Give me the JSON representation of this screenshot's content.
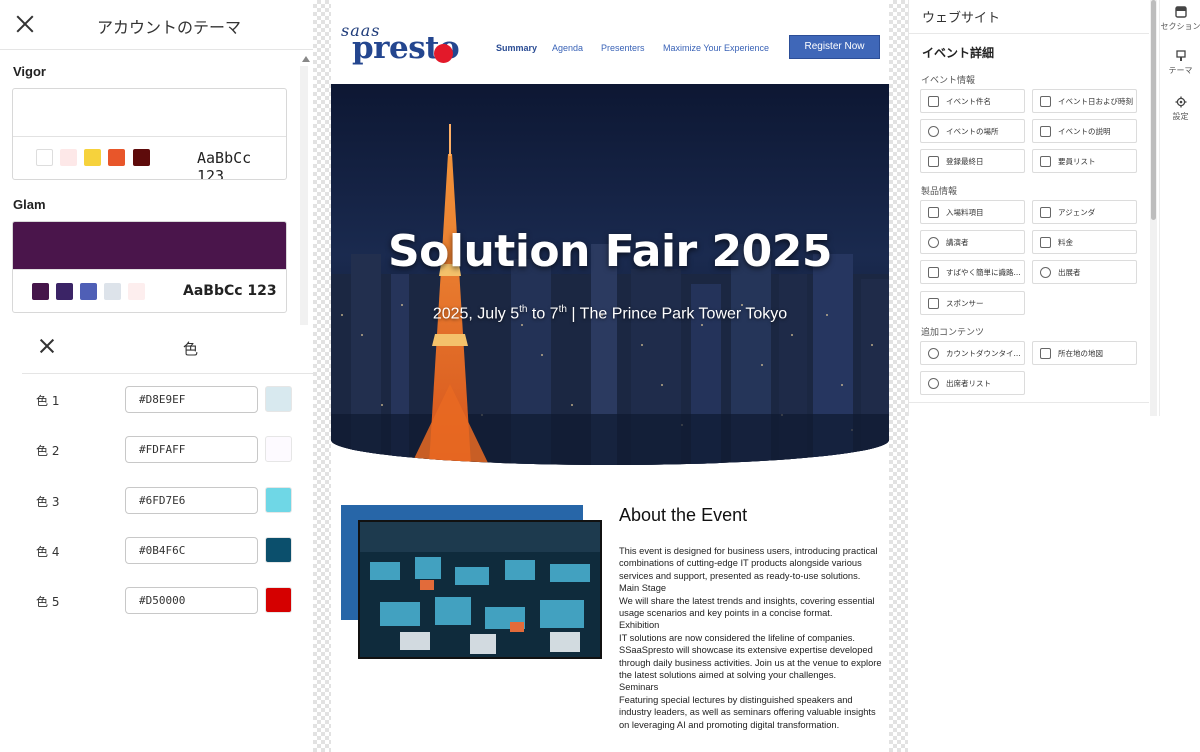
{
  "theme_panel": {
    "title": "アカウントのテーマ",
    "themes": [
      {
        "name": "Vigor",
        "sample": "AaBbCc 123",
        "colors": [
          "#ffffff",
          "#fde8e8",
          "#f6d23c",
          "#e8562a",
          "#5e0b0b"
        ]
      },
      {
        "name": "Glam",
        "sample": "AaBbCc 123",
        "top_color": "#4a154b",
        "colors": [
          "#45154a",
          "#3b2466",
          "#4f5fb6",
          "#dde3ea",
          "#fdeeee"
        ]
      }
    ]
  },
  "color_panel": {
    "title": "色",
    "colors": [
      {
        "label": "色 1",
        "hex": "#D8E9EF",
        "swatch": "#D8E9EF"
      },
      {
        "label": "色 2",
        "hex": "#FDFAFF",
        "swatch": "#FDFAFF"
      },
      {
        "label": "色 3",
        "hex": "#6FD7E6",
        "swatch": "#6FD7E6"
      },
      {
        "label": "色 4",
        "hex": "#0B4F6C",
        "swatch": "#0B4F6C"
      },
      {
        "label": "色 5",
        "hex": "#D50000",
        "swatch": "#D50000"
      }
    ]
  },
  "site": {
    "logo_top": "saas",
    "logo_main": "presto",
    "nav": [
      "Summary",
      "Agenda",
      "Presenters",
      "Maximize Your Experience"
    ],
    "register_label": "Register Now",
    "hero_title": "Solution Fair 2025",
    "hero_sub_a": "2025, July 5",
    "hero_sub_sup1": "th",
    "hero_sub_b": " to 7",
    "hero_sub_sup2": "th",
    "hero_sub_c": " | The Prince Park Tower Tokyo",
    "about_title": "About the Event",
    "about_body": "This  event is designed for business users, introducing practical combinations of cutting-edge IT products alongside various services and  support, presented as ready-to-use solutions.\nMain Stage\nWe will share the latest trends and insights, covering essential usage scenarios and key points in a concise format.\nExhibition\nIT  solutions are now considered the lifeline of companies. SSaaSpresto will showcase its extensive expertise developed through daily business  activities. Join us at the venue to explore the latest solutions aimed  at solving your challenges.\nSeminars\nFeaturing  special lectures by distinguished speakers and industry leaders, as  well as seminars offering valuable insights on leveraging AI and  promoting digital transformation."
  },
  "right_panel": {
    "title": "ウェブサイト",
    "heading": "イベント詳細",
    "groups": [
      {
        "label": "イベント情報",
        "items": [
          "イベント件名",
          "イベント日および時刻",
          "イベントの場所",
          "イベントの説明",
          "登録最終日",
          "要員リスト"
        ]
      },
      {
        "label": "製品情報",
        "items": [
          "入場料項目",
          "アジェンダ",
          "講演者",
          "料金",
          "すばやく簡単に識路...",
          "出展者",
          "スポンサー"
        ]
      },
      {
        "label": "追加コンテンツ",
        "items": [
          "カウントダウンタイ...",
          "所在地の地図",
          "出席者リスト"
        ]
      }
    ]
  },
  "rail": [
    {
      "label": "セクション",
      "icon": "section-icon"
    },
    {
      "label": "テーマ",
      "icon": "theme-icon"
    },
    {
      "label": "設定",
      "icon": "gear-icon"
    }
  ]
}
